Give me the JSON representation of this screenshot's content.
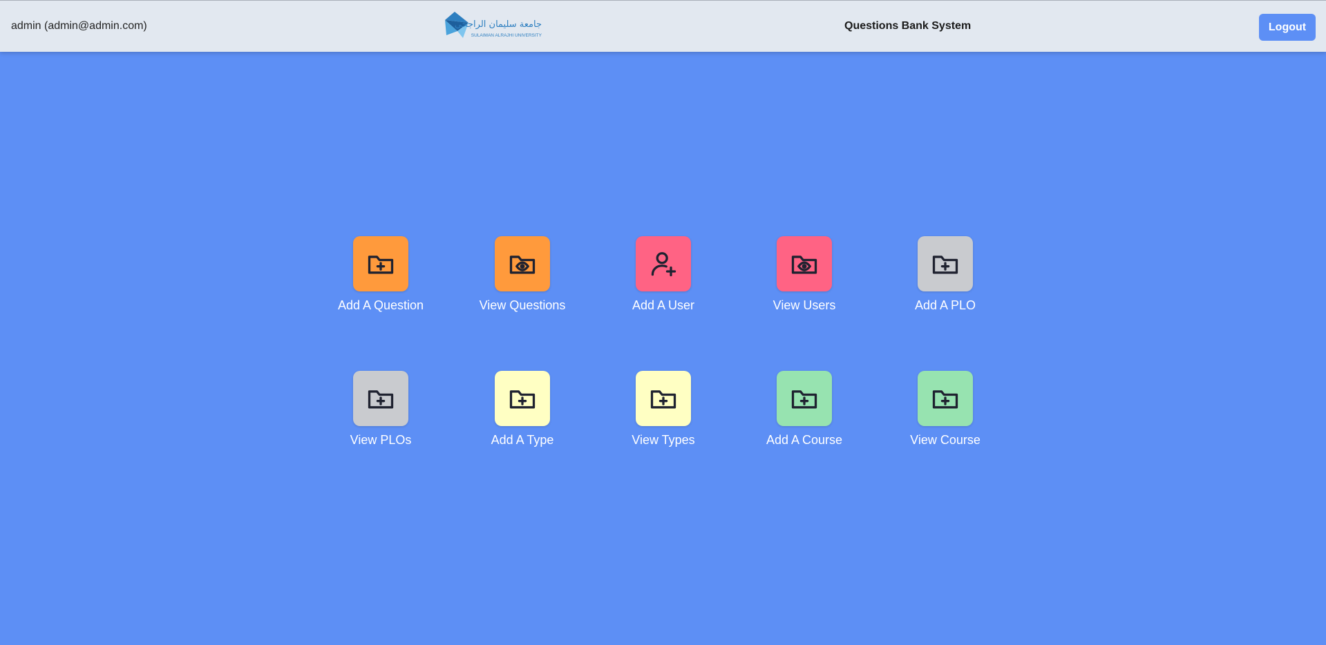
{
  "header": {
    "user": "admin (admin@admin.com)",
    "logo": {
      "arabic_text": "جامعة سليمان الراجحي",
      "english_text": "SULAIMAN ALRAJHI UNIVERSITY"
    },
    "title": "Questions Bank System",
    "logout_label": "Logout"
  },
  "colors": {
    "background": "#5d8ff5",
    "header": "#e2e8f0",
    "orange": "#ff9a3c",
    "pink": "#ff6384",
    "gray": "#c9cbcf",
    "yellow": "#ffffc3",
    "green": "#97e3b0"
  },
  "tiles": [
    {
      "label": "Add A Question",
      "icon": "folder-plus-icon"
    },
    {
      "label": "View Questions",
      "icon": "folder-eye-icon"
    },
    {
      "label": "Add A User",
      "icon": "user-plus-icon"
    },
    {
      "label": "View Users",
      "icon": "folder-eye-icon"
    },
    {
      "label": "Add A PLO",
      "icon": "folder-plus-icon"
    },
    {
      "label": "View PLOs",
      "icon": "folder-plus-icon"
    },
    {
      "label": "Add A Type",
      "icon": "folder-plus-icon"
    },
    {
      "label": "View Types",
      "icon": "folder-plus-icon"
    },
    {
      "label": "Add A Course",
      "icon": "folder-plus-icon"
    },
    {
      "label": "View Course",
      "icon": "folder-plus-icon"
    }
  ]
}
